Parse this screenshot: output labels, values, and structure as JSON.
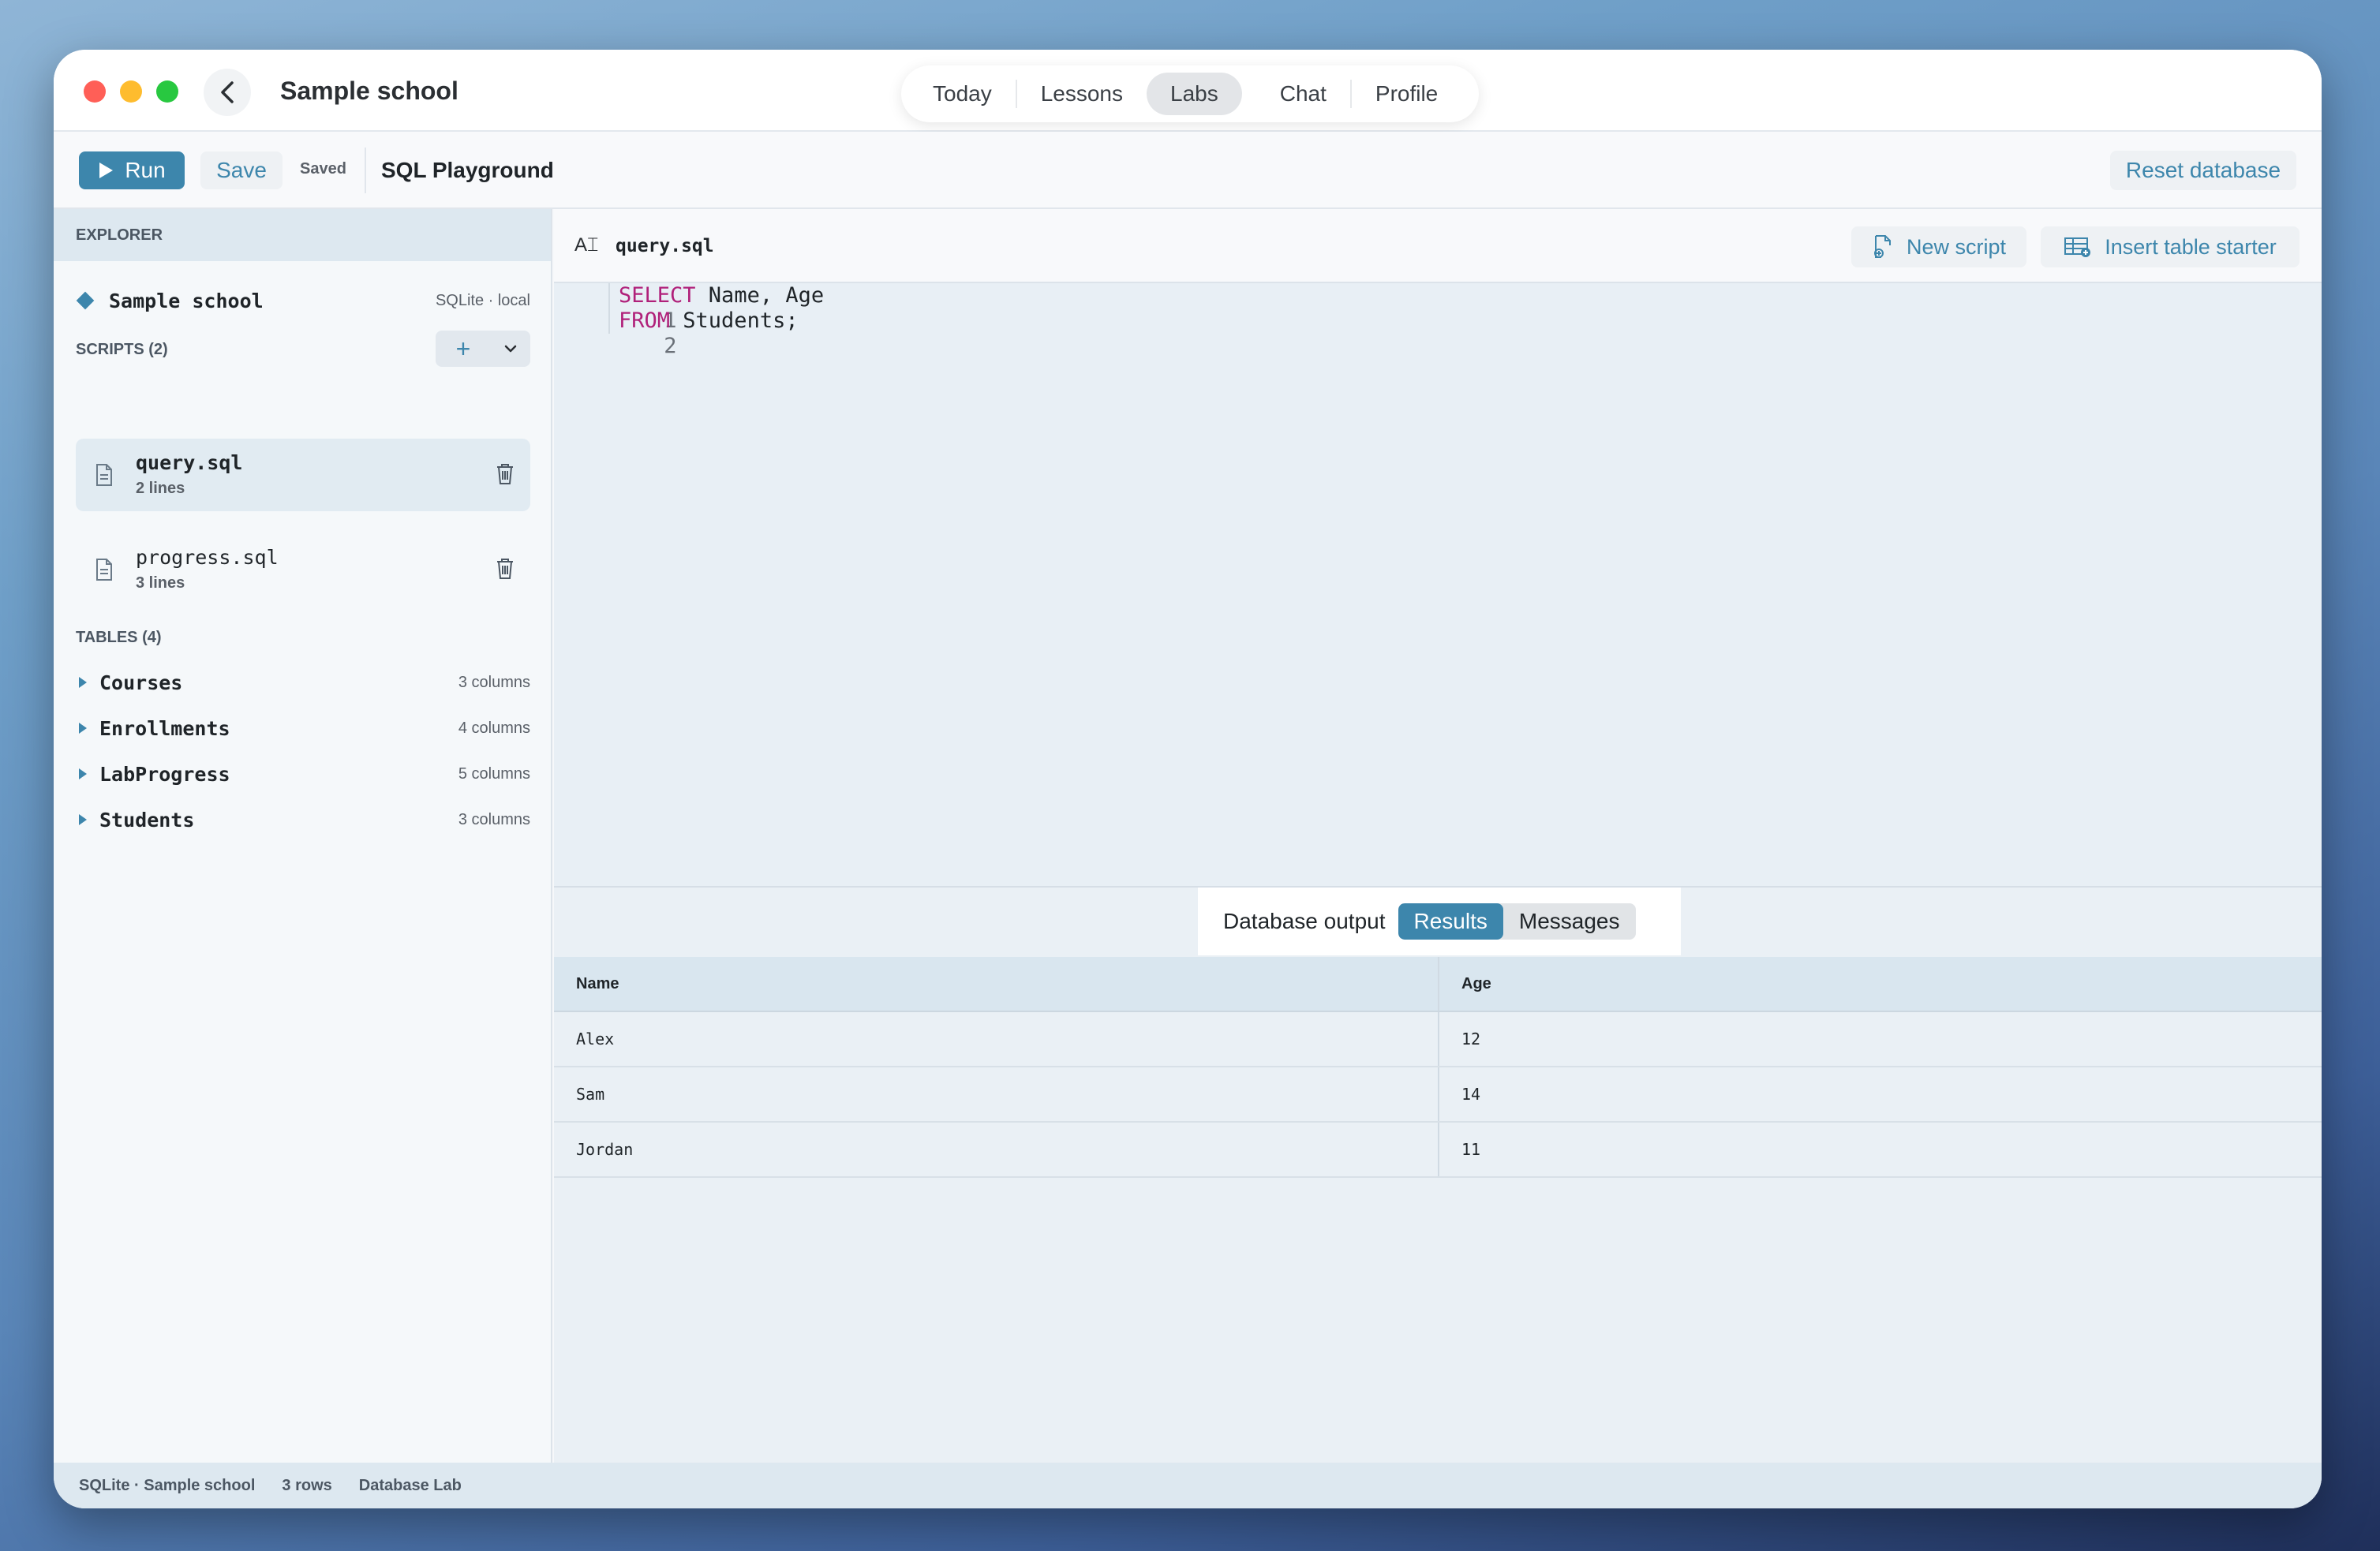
{
  "window": {
    "title": "Sample school",
    "nav_tabs": [
      {
        "label": "Today"
      },
      {
        "label": "Lessons"
      },
      {
        "label": "Labs"
      },
      {
        "label": "Chat"
      },
      {
        "label": "Profile"
      }
    ],
    "active_tab": "Labs"
  },
  "toolbar": {
    "run_label": "Run",
    "save_label": "Save",
    "saved_status": "Saved",
    "title": "SQL Playground",
    "reset_label": "Reset database"
  },
  "sidebar": {
    "header": "EXPLORER",
    "database": {
      "name": "Sample school",
      "meta": "SQLite · local"
    },
    "scripts_header": "SCRIPTS (2)",
    "scripts": [
      {
        "name": "query.sql",
        "lines": "2 lines",
        "active": true
      },
      {
        "name": "progress.sql",
        "lines": "3 lines",
        "active": false
      }
    ],
    "tables_header": "TABLES (4)",
    "tables": [
      {
        "name": "Courses",
        "columns": "3 columns"
      },
      {
        "name": "Enrollments",
        "columns": "4 columns"
      },
      {
        "name": "LabProgress",
        "columns": "5 columns"
      },
      {
        "name": "Students",
        "columns": "3 columns"
      }
    ]
  },
  "editor": {
    "file_name": "query.sql",
    "new_script_label": "New script",
    "insert_table_label": "Insert table starter",
    "lines": [
      {
        "num": "1",
        "keyword": "SELECT",
        "rest": " Name, Age"
      },
      {
        "num": "2",
        "keyword": "FROM",
        "rest": " Students;"
      }
    ]
  },
  "output": {
    "label": "Database output",
    "tabs": [
      {
        "label": "Results",
        "active": true
      },
      {
        "label": "Messages",
        "active": false
      }
    ],
    "columns": [
      "Name",
      "Age"
    ],
    "rows": [
      [
        "Alex",
        "12"
      ],
      [
        "Sam",
        "14"
      ],
      [
        "Jordan",
        "11"
      ]
    ]
  },
  "status": {
    "items": [
      "SQLite · Sample school",
      "3 rows",
      "Database Lab"
    ]
  },
  "colors": {
    "accent": "#3d86ac",
    "keyword": "#b0207a"
  }
}
